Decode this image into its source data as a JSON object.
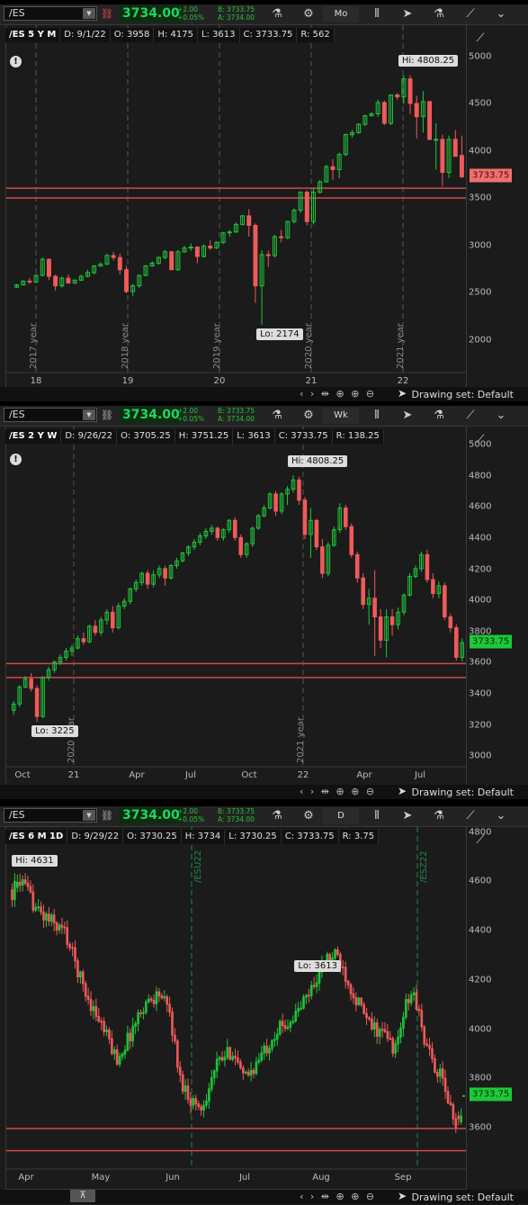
{
  "app": {
    "drawing_set": "Drawing set: Default"
  },
  "colors": {
    "up": "#1ec83a",
    "down": "#f05a5a",
    "support_line": "#d04a4a",
    "grid": "#2e2e2e",
    "last_price_bg": "#f26f6f"
  },
  "panels": [
    {
      "id": "p1",
      "toolbar": {
        "symbol": "/ES",
        "price": "3734.00",
        "change": "+2.00",
        "change_pct": "+0.05%",
        "bid": "B: 3733.75",
        "ask": "A: 3734.00",
        "aggregation": "Mo",
        "link_icon": "link-icon-red"
      },
      "header": {
        "title": "/ES 5 Y M",
        "date": "D: 9/1/22",
        "open": "O: 3958",
        "high": "H: 4175",
        "low": "L: 3613",
        "close": "C: 3733.75",
        "range": "R: 562"
      },
      "chart_data": {
        "type": "candlestick",
        "ylim": [
          1700,
          5300
        ],
        "yticks": [
          "5000",
          "4500",
          "4000",
          "3500",
          "3000",
          "2500",
          "2000"
        ],
        "xticks": [
          "18",
          "19",
          "20",
          "21",
          "22"
        ],
        "period_labels": [
          "2017 year",
          "2018 year",
          "2019 year",
          "2020 year",
          "2021 year"
        ],
        "last_price": "3733.75",
        "hi_label": "Hi: 4808.25",
        "lo_label": "Lo: 2174",
        "support_lines": [
          3613,
          3510
        ],
        "candles": [
          [
            2565,
            2600,
            2560,
            2590
          ],
          [
            2590,
            2640,
            2585,
            2630
          ],
          [
            2630,
            2660,
            2600,
            2620
          ],
          [
            2620,
            2700,
            2610,
            2690
          ],
          [
            2690,
            2880,
            2680,
            2860
          ],
          [
            2860,
            2870,
            2640,
            2680
          ],
          [
            2680,
            2700,
            2530,
            2580
          ],
          [
            2580,
            2680,
            2560,
            2660
          ],
          [
            2660,
            2700,
            2600,
            2610
          ],
          [
            2610,
            2650,
            2600,
            2640
          ],
          [
            2640,
            2700,
            2630,
            2680
          ],
          [
            2680,
            2750,
            2670,
            2720
          ],
          [
            2720,
            2800,
            2700,
            2790
          ],
          [
            2790,
            2830,
            2780,
            2810
          ],
          [
            2810,
            2920,
            2800,
            2900
          ],
          [
            2900,
            2940,
            2850,
            2880
          ],
          [
            2880,
            2920,
            2700,
            2750
          ],
          [
            2750,
            2790,
            2500,
            2520
          ],
          [
            2520,
            2600,
            2470,
            2580
          ],
          [
            2580,
            2700,
            2560,
            2690
          ],
          [
            2690,
            2800,
            2680,
            2790
          ],
          [
            2790,
            2840,
            2780,
            2820
          ],
          [
            2820,
            2890,
            2800,
            2880
          ],
          [
            2880,
            2960,
            2860,
            2940
          ],
          [
            2940,
            2950,
            2750,
            2750
          ],
          [
            2750,
            2960,
            2740,
            2940
          ],
          [
            2940,
            3000,
            2930,
            2980
          ],
          [
            2980,
            3030,
            2950,
            2990
          ],
          [
            2990,
            3000,
            2820,
            2890
          ],
          [
            2890,
            3020,
            2880,
            3000
          ],
          [
            3000,
            3060,
            2960,
            2980
          ],
          [
            2980,
            3050,
            2970,
            3040
          ],
          [
            3040,
            3150,
            3020,
            3140
          ],
          [
            3140,
            3170,
            3100,
            3150
          ],
          [
            3150,
            3250,
            3140,
            3230
          ],
          [
            3230,
            3330,
            3220,
            3320
          ],
          [
            3320,
            3390,
            3100,
            3220
          ],
          [
            3220,
            3240,
            2400,
            2580
          ],
          [
            2580,
            2960,
            2170,
            2910
          ],
          [
            2910,
            2950,
            2780,
            2900
          ],
          [
            2900,
            3120,
            2880,
            3100
          ],
          [
            3100,
            3170,
            3040,
            3090
          ],
          [
            3090,
            3270,
            3070,
            3260
          ],
          [
            3260,
            3400,
            3240,
            3380
          ],
          [
            3380,
            3580,
            3350,
            3570
          ],
          [
            3570,
            3590,
            3220,
            3260
          ],
          [
            3260,
            3620,
            3230,
            3570
          ],
          [
            3570,
            3700,
            3560,
            3680
          ],
          [
            3680,
            3860,
            3680,
            3840
          ],
          [
            3840,
            3920,
            3700,
            3810
          ],
          [
            3810,
            3990,
            3720,
            3970
          ],
          [
            3970,
            4190,
            3950,
            4180
          ],
          [
            4180,
            4230,
            4150,
            4200
          ],
          [
            4200,
            4300,
            4190,
            4290
          ],
          [
            4290,
            4390,
            4270,
            4380
          ],
          [
            4380,
            4420,
            4370,
            4400
          ],
          [
            4400,
            4550,
            4370,
            4520
          ],
          [
            4520,
            4540,
            4280,
            4300
          ],
          [
            4300,
            4600,
            4280,
            4600
          ],
          [
            4600,
            4620,
            4550,
            4580
          ],
          [
            4580,
            4810,
            4500,
            4770
          ],
          [
            4770,
            4810,
            4400,
            4510
          ],
          [
            4510,
            4590,
            4140,
            4370
          ],
          [
            4370,
            4640,
            4200,
            4530
          ],
          [
            4530,
            4520,
            4120,
            4130
          ],
          [
            4130,
            4300,
            3810,
            4130
          ],
          [
            4130,
            4180,
            3630,
            3780
          ],
          [
            3780,
            4170,
            3720,
            4130
          ],
          [
            4130,
            4230,
            3960,
            3950
          ],
          [
            3960,
            4170,
            3720,
            3734
          ]
        ]
      }
    },
    {
      "id": "p2",
      "toolbar": {
        "symbol": "/ES",
        "price": "3734.00",
        "change": "+2.00",
        "change_pct": "+0.05%",
        "bid": "B: 3733.75",
        "ask": "A: 3734.00",
        "aggregation": "Wk",
        "link_icon": "link-icon"
      },
      "header": {
        "title": "/ES 2 Y W",
        "date": "D: 9/26/22",
        "open": "O: 3705.25",
        "high": "H: 3751.25",
        "low": "L: 3613",
        "close": "C: 3733.75",
        "range": "R: 138.25"
      },
      "chart_data": {
        "type": "candlestick",
        "ylim": [
          2960,
          5100
        ],
        "yticks": [
          "5000",
          "4800",
          "4600",
          "4400",
          "4200",
          "4000",
          "3800",
          "3600",
          "3400",
          "3200",
          "3000"
        ],
        "xticks": [
          "Oct",
          "21",
          "Apr",
          "Jul",
          "Oct",
          "22",
          "Apr",
          "Jul"
        ],
        "period_labels": [
          "2020 year",
          "2021 year"
        ],
        "last_price": "3733.75",
        "hi_label": "Hi: 4808.25",
        "lo_label": "Lo: 3225",
        "support_lines": [
          3600,
          3510
        ],
        "candles": [
          [
            3300,
            3360,
            3270,
            3340
          ],
          [
            3340,
            3460,
            3320,
            3450
          ],
          [
            3450,
            3520,
            3440,
            3500
          ],
          [
            3500,
            3540,
            3420,
            3440
          ],
          [
            3440,
            3460,
            3225,
            3260
          ],
          [
            3260,
            3520,
            3250,
            3510
          ],
          [
            3510,
            3580,
            3490,
            3560
          ],
          [
            3560,
            3620,
            3540,
            3610
          ],
          [
            3610,
            3660,
            3590,
            3640
          ],
          [
            3640,
            3700,
            3620,
            3680
          ],
          [
            3680,
            3720,
            3650,
            3700
          ],
          [
            3700,
            3780,
            3690,
            3760
          ],
          [
            3760,
            3800,
            3720,
            3740
          ],
          [
            3740,
            3850,
            3730,
            3840
          ],
          [
            3840,
            3880,
            3780,
            3800
          ],
          [
            3800,
            3900,
            3780,
            3880
          ],
          [
            3880,
            3950,
            3850,
            3930
          ],
          [
            3930,
            3970,
            3800,
            3830
          ],
          [
            3830,
            3990,
            3820,
            3970
          ],
          [
            3970,
            4020,
            3950,
            4000
          ],
          [
            4000,
            4090,
            3980,
            4080
          ],
          [
            4080,
            4140,
            4060,
            4120
          ],
          [
            4120,
            4190,
            4100,
            4180
          ],
          [
            4180,
            4200,
            4080,
            4110
          ],
          [
            4110,
            4200,
            4090,
            4170
          ],
          [
            4170,
            4230,
            4150,
            4210
          ],
          [
            4210,
            4230,
            4100,
            4150
          ],
          [
            4150,
            4240,
            4140,
            4230
          ],
          [
            4230,
            4280,
            4210,
            4260
          ],
          [
            4260,
            4320,
            4250,
            4310
          ],
          [
            4310,
            4360,
            4290,
            4350
          ],
          [
            4350,
            4400,
            4330,
            4380
          ],
          [
            4380,
            4440,
            4360,
            4420
          ],
          [
            4420,
            4470,
            4400,
            4450
          ],
          [
            4450,
            4490,
            4430,
            4470
          ],
          [
            4470,
            4480,
            4390,
            4410
          ],
          [
            4410,
            4470,
            4390,
            4460
          ],
          [
            4460,
            4530,
            4440,
            4520
          ],
          [
            4520,
            4540,
            4390,
            4410
          ],
          [
            4410,
            4430,
            4280,
            4300
          ],
          [
            4300,
            4380,
            4280,
            4370
          ],
          [
            4370,
            4480,
            4350,
            4470
          ],
          [
            4470,
            4560,
            4460,
            4550
          ],
          [
            4550,
            4620,
            4540,
            4600
          ],
          [
            4600,
            4700,
            4590,
            4690
          ],
          [
            4690,
            4710,
            4550,
            4580
          ],
          [
            4580,
            4700,
            4560,
            4690
          ],
          [
            4690,
            4740,
            4620,
            4720
          ],
          [
            4720,
            4810,
            4700,
            4780
          ],
          [
            4780,
            4800,
            4620,
            4650
          ],
          [
            4650,
            4670,
            4400,
            4430
          ],
          [
            4430,
            4600,
            4280,
            4520
          ],
          [
            4520,
            4530,
            4330,
            4350
          ],
          [
            4350,
            4400,
            4150,
            4180
          ],
          [
            4180,
            4380,
            4160,
            4360
          ],
          [
            4360,
            4480,
            4350,
            4460
          ],
          [
            4460,
            4630,
            4440,
            4600
          ],
          [
            4600,
            4620,
            4460,
            4480
          ],
          [
            4480,
            4500,
            4280,
            4300
          ],
          [
            4300,
            4320,
            4120,
            4150
          ],
          [
            4150,
            4180,
            3950,
            3980
          ],
          [
            3980,
            4080,
            3850,
            4020
          ],
          [
            4020,
            4200,
            3650,
            3900
          ],
          [
            3900,
            3950,
            3700,
            3750
          ],
          [
            3750,
            3950,
            3640,
            3900
          ],
          [
            3900,
            3950,
            3780,
            3850
          ],
          [
            3850,
            3960,
            3820,
            3930
          ],
          [
            3930,
            4050,
            3910,
            4040
          ],
          [
            4040,
            4180,
            4030,
            4160
          ],
          [
            4160,
            4230,
            4150,
            4210
          ],
          [
            4210,
            4320,
            4190,
            4300
          ],
          [
            4300,
            4330,
            4120,
            4140
          ],
          [
            4140,
            4180,
            4020,
            4050
          ],
          [
            4050,
            4130,
            4020,
            4100
          ],
          [
            4100,
            4120,
            3880,
            3900
          ],
          [
            3900,
            3920,
            3800,
            3830
          ],
          [
            3830,
            3850,
            3620,
            3640
          ],
          [
            3640,
            3760,
            3613,
            3734
          ]
        ]
      }
    },
    {
      "id": "p3",
      "toolbar": {
        "symbol": "/ES",
        "price": "3734.00",
        "change": "+2.00",
        "change_pct": "+0.05%",
        "bid": "B: 3733.75",
        "ask": "A: 3734.00",
        "aggregation": "D",
        "link_icon": "link-icon"
      },
      "header": {
        "title": "/ES 6 M 1D",
        "date": "D: 9/29/22",
        "open": "O: 3730.25",
        "high": "H: 3734",
        "low": "L: 3730.25",
        "close": "C: 3733.75",
        "range": "R: 3.75"
      },
      "chart_data": {
        "type": "candlestick",
        "ylim": [
          3450,
          4810
        ],
        "yticks": [
          "4800",
          "4600",
          "4400",
          "4200",
          "4000",
          "3800",
          "3600"
        ],
        "xticks": [
          "Apr",
          "May",
          "Jun",
          "Jul",
          "Aug",
          "Sep"
        ],
        "period_labels": [
          "/ESU22",
          "/ESZ22"
        ],
        "last_price": "3733.75",
        "hi_label": "Hi: 4631",
        "lo_label": "Lo: 3613",
        "support_lines": [
          3600,
          3510
        ]
      }
    }
  ]
}
